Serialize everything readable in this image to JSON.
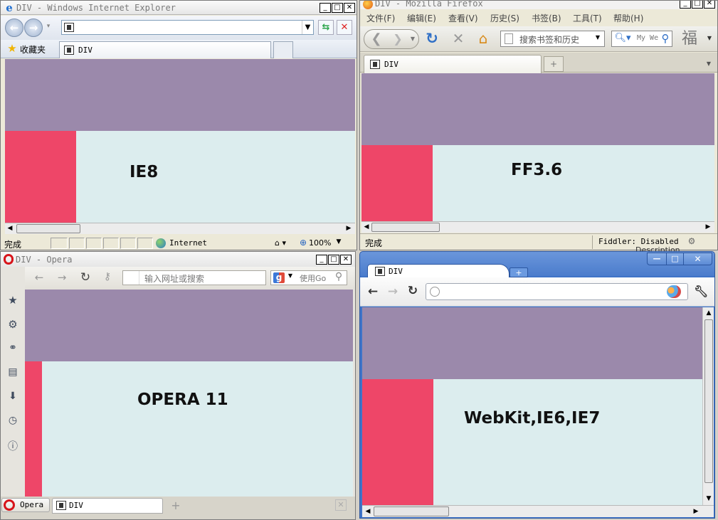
{
  "ie8": {
    "title": "DIV - Windows Internet Explorer",
    "favorites_label": "收藏夹",
    "tab_label": "DIV",
    "content_label": "IE8",
    "status_text": "完成",
    "zone_label": "Internet",
    "zoom_label": "100%"
  },
  "firefox": {
    "title": "DIV - Mozilla Firefox",
    "menu": [
      "文件(F)",
      "编辑(E)",
      "查看(V)",
      "历史(S)",
      "书签(B)",
      "工具(T)",
      "帮助(H)"
    ],
    "bookmarks_search_placeholder": "搜索书签和历史",
    "search_placeholder": "My We",
    "tab_label": "DIV",
    "content_label": "FF3.6",
    "status_text": "完成",
    "fiddler_text": "Fiddler: Disabled"
  },
  "opera": {
    "title": "DIV - Opera",
    "address_placeholder": "输入网址或搜索",
    "search_placeholder": "使用Go",
    "content_label": "OPERA 11",
    "menu_button_label": "Opera",
    "tab_label": "DIV"
  },
  "chrome": {
    "tab_label": "DIV",
    "content_label": "WebKit,IE6,IE7",
    "behind_text": "Description"
  },
  "colors": {
    "purple": "#9b89ab",
    "light_cyan": "#dcedee",
    "red": "#ee4668"
  }
}
